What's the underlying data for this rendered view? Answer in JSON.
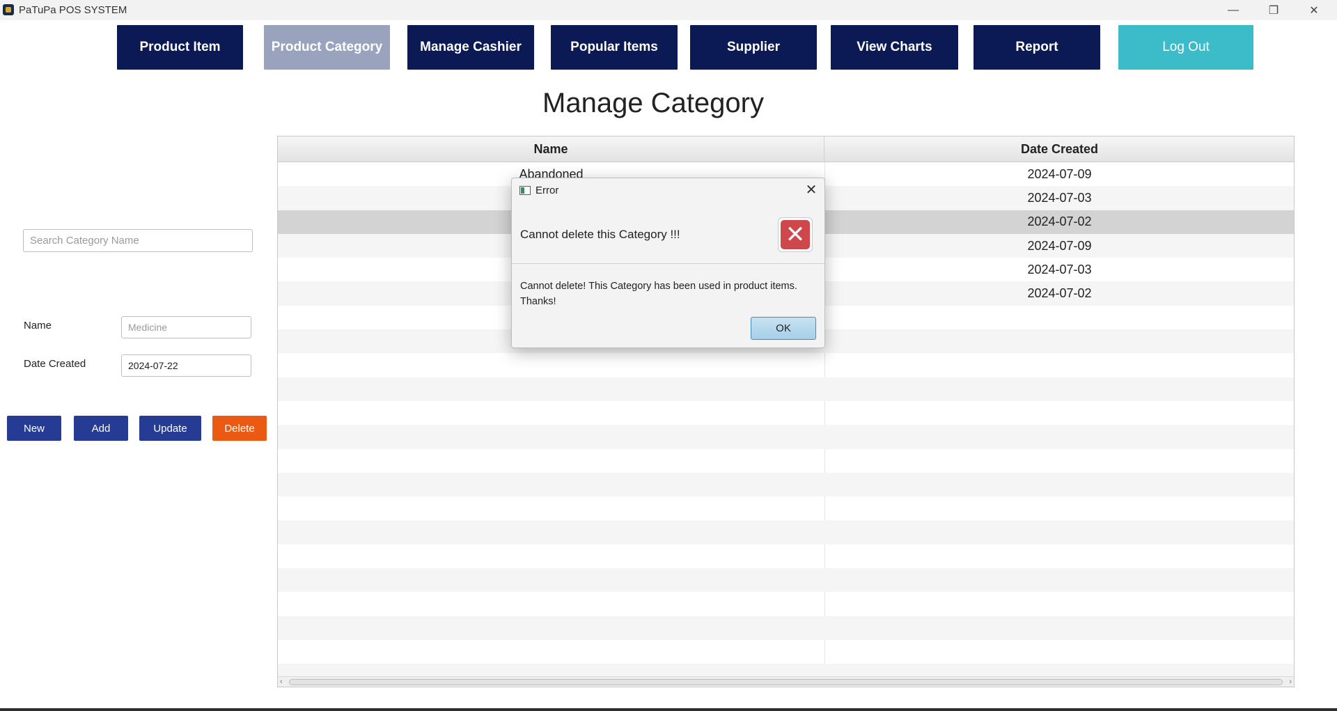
{
  "window": {
    "title": "PaTuPa POS SYSTEM",
    "minimize_glyph": "—",
    "maximize_glyph": "❐",
    "close_glyph": "✕"
  },
  "nav": {
    "product_item": "Product Item",
    "product_category": "Product Category",
    "manage_cashier": "Manage Cashier",
    "popular_items": "Popular Items",
    "supplier": "Supplier",
    "view_charts": "View Charts",
    "report": "Report",
    "log_out": "Log Out",
    "active": "Product Category"
  },
  "page": {
    "title": "Manage Category"
  },
  "form": {
    "search_placeholder": "Search Category Name",
    "name_label": "Name",
    "name_placeholder": "Medicine",
    "name_value": "",
    "date_label": "Date Created",
    "date_value": "2024-07-22",
    "new_label": "New",
    "add_label": "Add",
    "update_label": "Update",
    "delete_label": "Delete"
  },
  "table": {
    "headers": {
      "name": "Name",
      "date": "Date Created"
    },
    "rows": [
      {
        "name": "Abandoned",
        "date": "2024-07-09"
      },
      {
        "name": "",
        "date": "2024-07-03"
      },
      {
        "name": "",
        "date": "2024-07-02"
      },
      {
        "name": "",
        "date": "2024-07-09"
      },
      {
        "name": "",
        "date": "2024-07-03"
      },
      {
        "name": "",
        "date": "2024-07-02"
      }
    ],
    "selected_row_index": 2,
    "empty_row_count": 16
  },
  "dialog": {
    "title": "Error",
    "header": "Cannot delete this Category !!!",
    "content_line1": "Cannot delete! This Category has been used in product items.",
    "content_line2": "Thanks!",
    "ok_label": "OK",
    "close_glyph": "✕",
    "error_glyph": "✕"
  },
  "colors": {
    "nav_bg": "#0b1a54",
    "nav_active_bg": "#9aa3bd",
    "logout_bg": "#3cbcc8",
    "action_bg": "#253b94",
    "delete_bg": "#ea5a12",
    "error_red": "#d0474b"
  }
}
